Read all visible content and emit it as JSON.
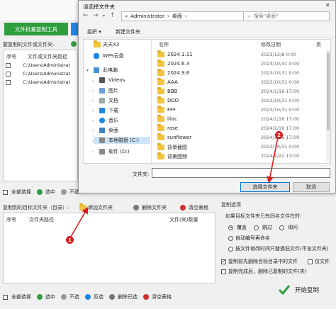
{
  "app": {
    "batch_copy_btn": "文件批量复制工具",
    "source_header": "要复制的文件或文件夹:",
    "source_table": {
      "col_no": "序号",
      "col_path": "文件或文件夹路径"
    },
    "source_rows": [
      "C:\\Users\\Administrat",
      "C:\\Users\\Administrat",
      "C:\\Users\\Administrat"
    ],
    "source_tools": {
      "select_all": "全部选择",
      "select": "选中",
      "deselect": "不选"
    },
    "target_header": "复制到的目标文件夹（目录）:",
    "add_folder": "添加文件夹",
    "delete_folder": "删除文件夹",
    "clear_table": "清空表格",
    "target_table": {
      "col_no": "序号",
      "col_path": "文件夹路径",
      "col_count": "文件(夹)数量"
    },
    "target_tools": {
      "select_all": "全部选择",
      "select": "选中",
      "deselect": "不选",
      "invert": "反选",
      "delete_selected": "删除已选",
      "clear_table": "清空表格"
    },
    "copy_options": {
      "title": "复制选项",
      "question": "如果目标文件夹已有同名文件在时:",
      "r_overwrite": "覆盖",
      "r_skip": "跳过",
      "r_ask": "询问",
      "r_auto_number": "自动编号再命名",
      "r_by_time": "按文件修改时间只替换旧文件(不含文件夹)",
      "c_clear_first": "复制前先删除目标目录中的文件",
      "c_files_only": "仅文件",
      "c_delete_after": "复制完成后，删除已复制的文件(夹)"
    },
    "start_copy": "开始复制"
  },
  "dialog": {
    "title": "请选择文件夹",
    "addr_parts": [
      "«",
      "Administrator",
      "›",
      "桌面",
      "›"
    ],
    "search_placeholder": "搜索\"桌面\"",
    "organize": "组织 ▾",
    "new_folder": "新建文件夹",
    "tree": [
      "天天X3",
      "WPS云盘",
      "此电脑",
      "Videos",
      "图片",
      "文档",
      "下载",
      "音乐",
      "桌面",
      "本地磁盘 (C:)",
      "软件 (D:)"
    ],
    "col_name": "名称",
    "col_date": "修改日期",
    "col_type": "类",
    "files": [
      {
        "name": "2024.1.11",
        "date": "2023/12/8 0:00"
      },
      {
        "name": "2024.6.3",
        "date": "2023/10/31 0:00"
      },
      {
        "name": "2024.9.6",
        "date": "2023/10/31 0:00"
      },
      {
        "name": "AAA",
        "date": "2023/10/31 0:00"
      },
      {
        "name": "BBB",
        "date": "2024/1/16 17:00"
      },
      {
        "name": "DDD",
        "date": "2023/10/31 0:00"
      },
      {
        "name": "FFF",
        "date": "2023/10/31 0:00"
      },
      {
        "name": "lilac",
        "date": "2024/1/16 17:00"
      },
      {
        "name": "rose",
        "date": "2024/1/16 17:00"
      },
      {
        "name": "sunflower",
        "date": "2024/1/16 17:00"
      },
      {
        "name": "背景截图",
        "date": "2023/10/31 0:00"
      },
      {
        "name": "背景图频",
        "date": "2024/1/22 13:00"
      }
    ],
    "filename_label": "文件夹:",
    "select_btn": "选择文件夹",
    "cancel_btn": "取消"
  },
  "markers": {
    "m1": "1",
    "m2": "2"
  },
  "colors": {
    "green": "#2e9e3e",
    "blue": "#1e88e5",
    "marker": "#d81e1e",
    "folder": "#f3c43f"
  }
}
